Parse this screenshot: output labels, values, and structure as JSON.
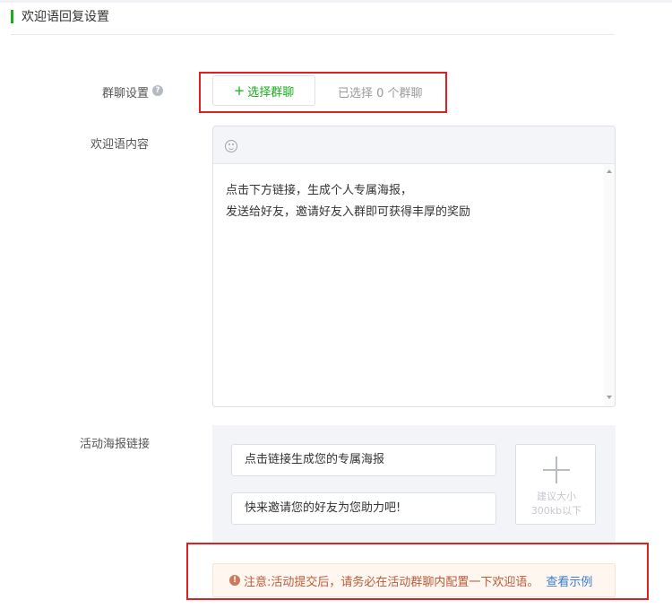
{
  "section": {
    "title": "欢迎语回复设置"
  },
  "group_chat": {
    "label": "群聊设置",
    "help_icon": "question-icon",
    "select_button": {
      "icon": "+",
      "label": "选择群聊"
    },
    "selected_text": "已选择 0 个群聊"
  },
  "welcome": {
    "label": "欢迎语内容",
    "toolbar_icon": "emoji-icon",
    "lines": [
      "点击下方链接，生成个人专属海报，",
      "发送给好友，邀请好友入群即可获得丰厚的奖励"
    ]
  },
  "poster": {
    "label": "活动海报链接",
    "title_value": "点击链接生成您的专属海报",
    "desc_value": "快来邀请您的好友为您助力吧!",
    "upload": {
      "hint_line1": "建议大小",
      "hint_line2": "300kb以下"
    }
  },
  "notice": {
    "icon": "!",
    "text": "注意:活动提交后，请务必在活动群聊内配置一下欢迎语。",
    "link": "查看示例"
  },
  "colors": {
    "accent": "#1aad19",
    "highlight": "#e02020",
    "link": "#3a7bd5",
    "warning": "#b85c3a"
  }
}
